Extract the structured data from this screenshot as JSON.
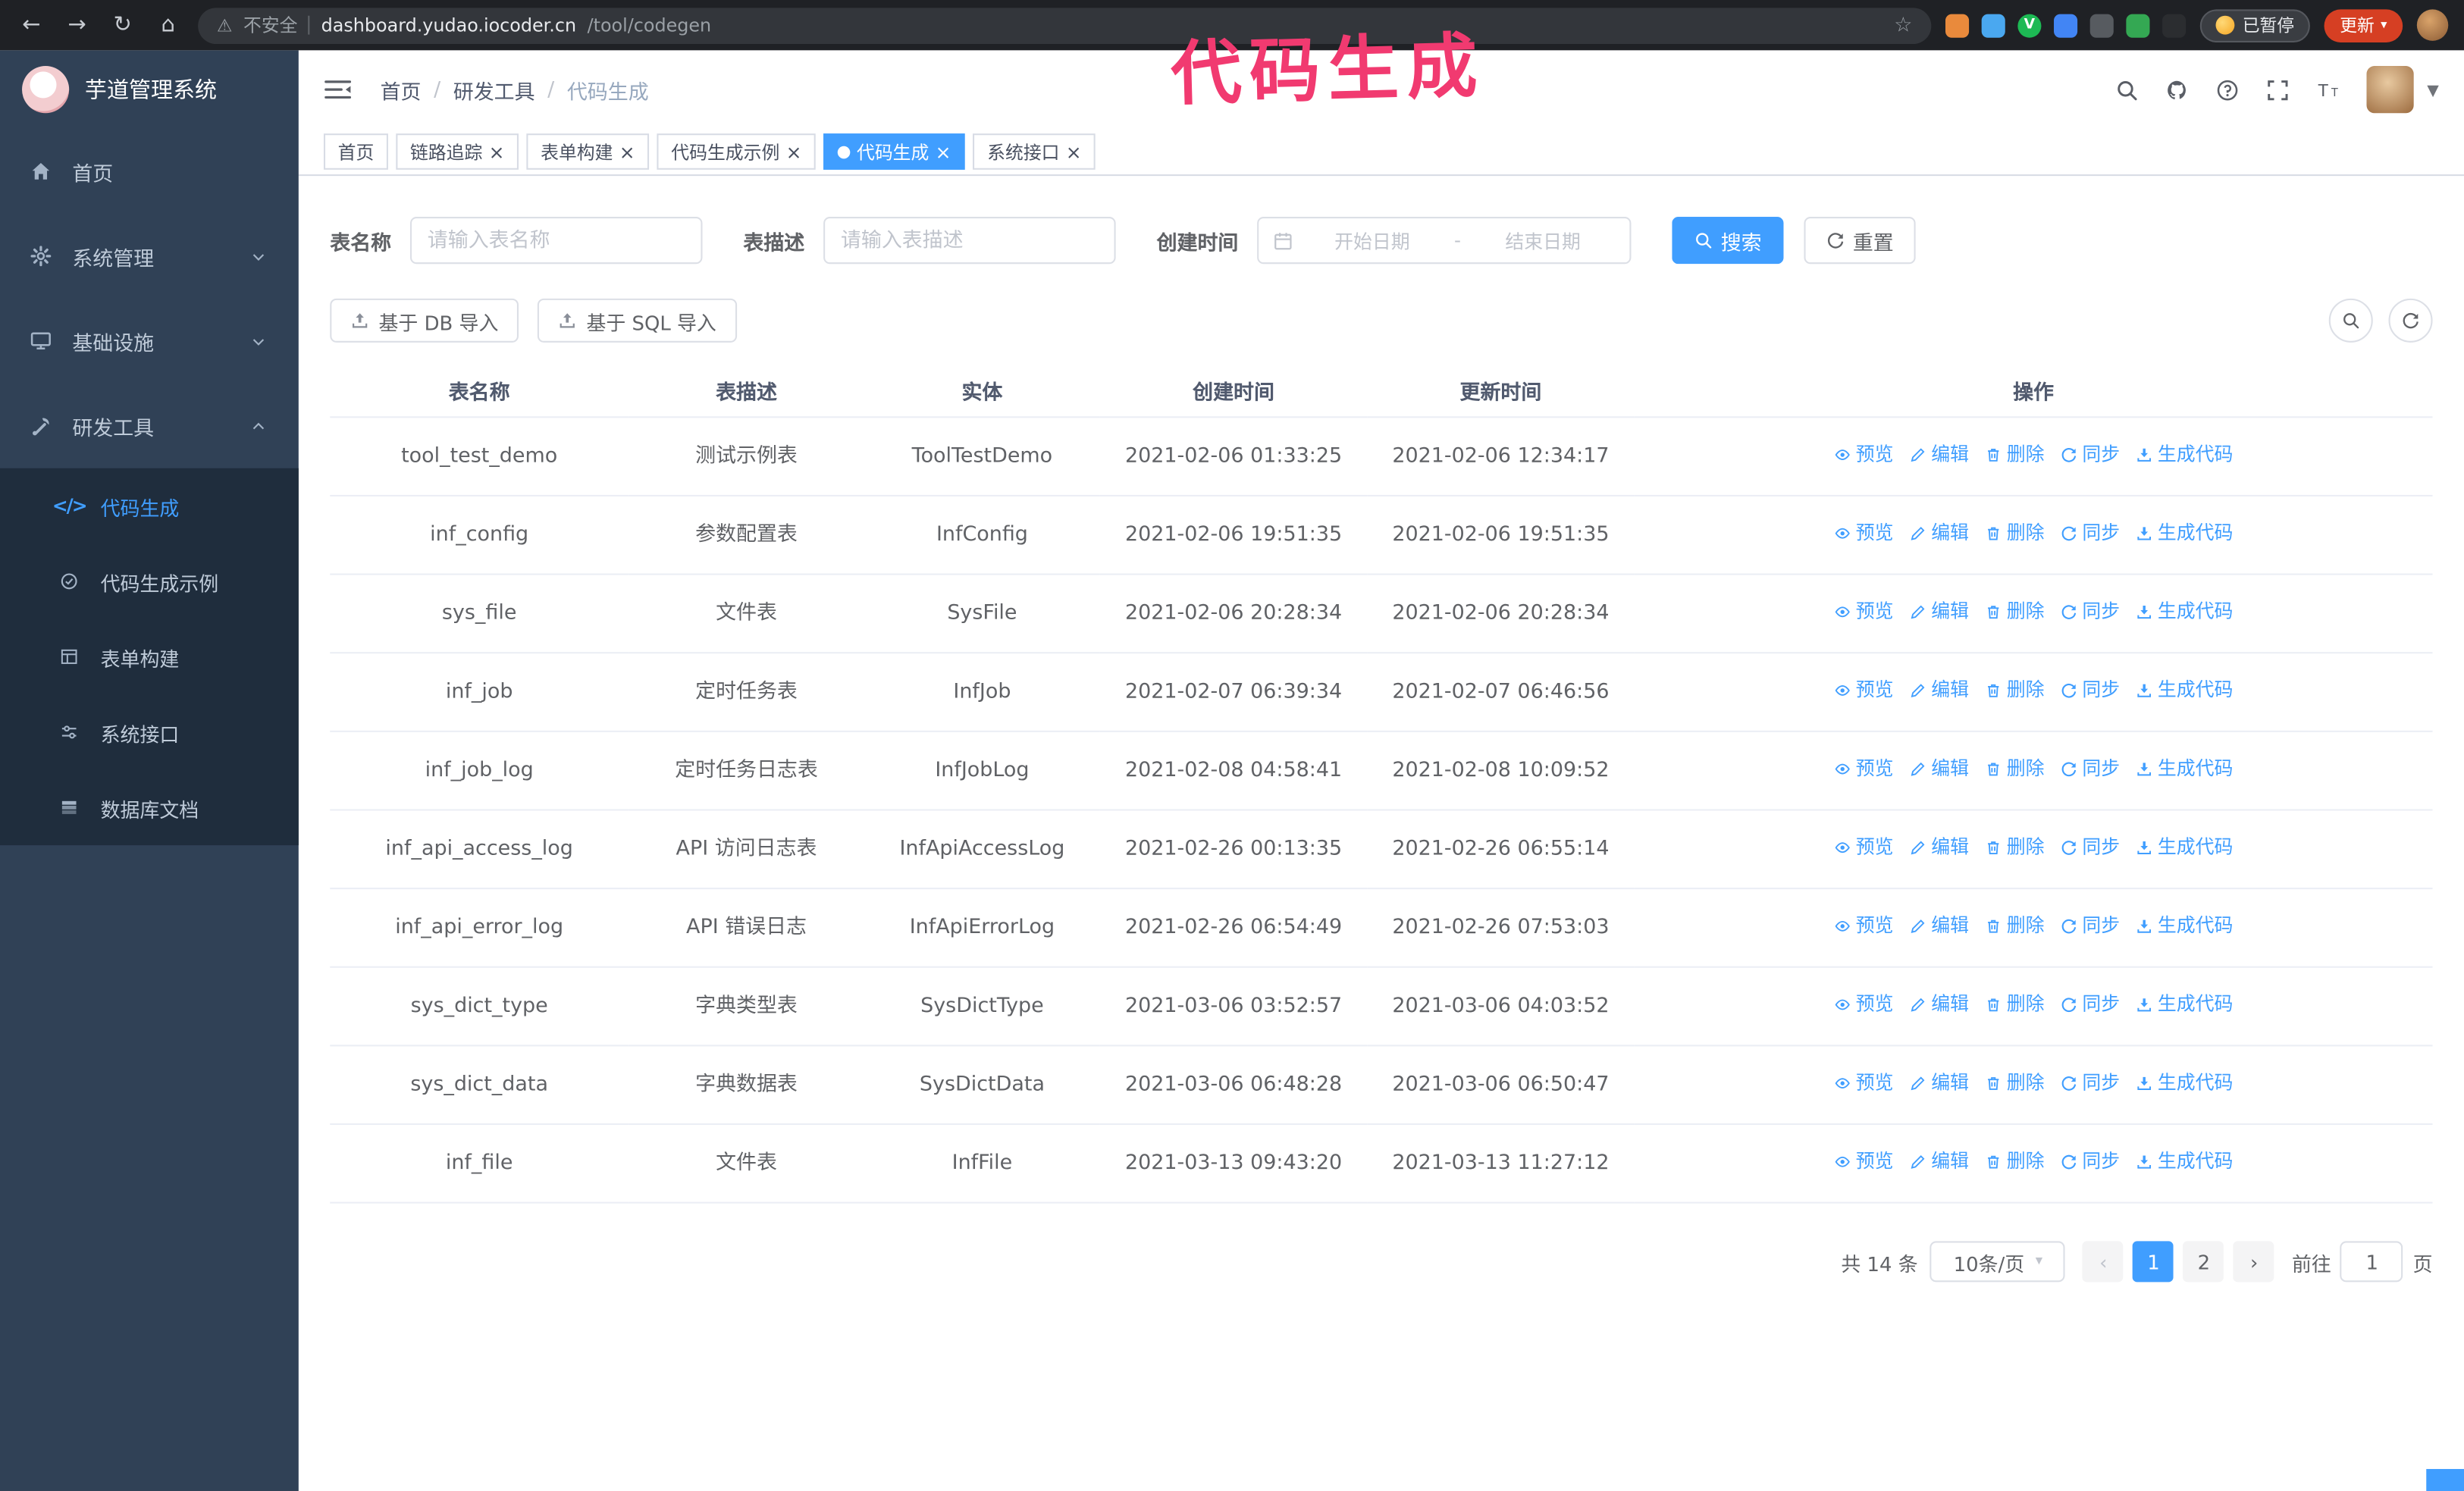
{
  "annotation": {
    "text": "代码生成"
  },
  "colors": {
    "accent": "#409eff",
    "sidebar_bg": "#304156",
    "submenu_bg": "#1f2d3d",
    "annotation": "#f13a70",
    "update_button": "#d63f23",
    "tab_active": "#409eff"
  },
  "browser": {
    "insecure_label": "不安全",
    "url_host": "dashboard.yudao.iocoder.cn",
    "url_path": "/tool/codegen",
    "paused_label": "已暂停",
    "update_label": "更新",
    "extensions": [
      {
        "name": "extension-icon-1",
        "color": "#e98a3c",
        "shape": "square"
      },
      {
        "name": "extension-icon-2",
        "color": "#4aa8f0",
        "shape": "square"
      },
      {
        "name": "extension-icon-3",
        "color": "#1db954",
        "shape": "circle",
        "letter": "V"
      },
      {
        "name": "extension-icon-4",
        "color": "#4285f4",
        "shape": "square"
      },
      {
        "name": "extension-icon-5",
        "color": "#575b60",
        "shape": "square"
      },
      {
        "name": "extension-icon-6",
        "color": "#34a853",
        "shape": "square"
      },
      {
        "name": "extension-icon-7",
        "color": "#2b2d30",
        "shape": "square"
      }
    ]
  },
  "sidebar": {
    "logo_title": "芋道管理系统",
    "menu": [
      {
        "key": "home",
        "label": "首页",
        "icon": "home-icon",
        "arrow": null
      },
      {
        "key": "system-manage",
        "label": "系统管理",
        "icon": "gear-icon",
        "arrow": "down"
      },
      {
        "key": "infrastructure",
        "label": "基础设施",
        "icon": "monitor-icon",
        "arrow": "down"
      },
      {
        "key": "devtools",
        "label": "研发工具",
        "icon": "tools-icon",
        "arrow": "up"
      }
    ],
    "submenu": [
      {
        "key": "codegen",
        "label": "代码生成",
        "icon": "code-icon",
        "active": true
      },
      {
        "key": "codegen-example",
        "label": "代码生成示例",
        "icon": "badge-icon",
        "active": false
      },
      {
        "key": "form-build",
        "label": "表单构建",
        "icon": "form-icon",
        "active": false
      },
      {
        "key": "system-api",
        "label": "系统接口",
        "icon": "api-icon",
        "active": false
      },
      {
        "key": "db-doc",
        "label": "数据库文档",
        "icon": "database-icon",
        "active": false
      }
    ]
  },
  "header": {
    "breadcrumb": [
      "首页",
      "研发工具",
      "代码生成"
    ],
    "separator": "/"
  },
  "tabs": [
    {
      "key": "home",
      "label": "首页",
      "closable": false,
      "active": false
    },
    {
      "key": "tracer",
      "label": "链路追踪",
      "closable": true,
      "active": false
    },
    {
      "key": "form-build",
      "label": "表单构建",
      "closable": true,
      "active": false
    },
    {
      "key": "codegen-example",
      "label": "代码生成示例",
      "closable": true,
      "active": false
    },
    {
      "key": "codegen",
      "label": "代码生成",
      "closable": true,
      "active": true
    },
    {
      "key": "system-api",
      "label": "系统接口",
      "closable": true,
      "active": false
    }
  ],
  "filters": {
    "table_name_label": "表名称",
    "table_name_placeholder": "请输入表名称",
    "table_desc_label": "表描述",
    "table_desc_placeholder": "请输入表描述",
    "create_time_label": "创建时间",
    "date_start_placeholder": "开始日期",
    "date_separator": "-",
    "date_end_placeholder": "结束日期",
    "search_label": "搜索",
    "reset_label": "重置"
  },
  "toolbar": {
    "import_db_label": "基于 DB 导入",
    "import_sql_label": "基于 SQL 导入"
  },
  "table": {
    "columns": [
      "表名称",
      "表描述",
      "实体",
      "创建时间",
      "更新时间",
      "操作"
    ],
    "actions": [
      "预览",
      "编辑",
      "删除",
      "同步",
      "生成代码"
    ],
    "rows": [
      {
        "name": "tool_test_demo",
        "desc": "测试示例表",
        "entity": "ToolTestDemo",
        "created": "2021-02-06 01:33:25",
        "updated": "2021-02-06 12:34:17"
      },
      {
        "name": "inf_config",
        "desc": "参数配置表",
        "entity": "InfConfig",
        "created": "2021-02-06 19:51:35",
        "updated": "2021-02-06 19:51:35"
      },
      {
        "name": "sys_file",
        "desc": "文件表",
        "entity": "SysFile",
        "created": "2021-02-06 20:28:34",
        "updated": "2021-02-06 20:28:34"
      },
      {
        "name": "inf_job",
        "desc": "定时任务表",
        "entity": "InfJob",
        "created": "2021-02-07 06:39:34",
        "updated": "2021-02-07 06:46:56"
      },
      {
        "name": "inf_job_log",
        "desc": "定时任务日志表",
        "entity": "InfJobLog",
        "created": "2021-02-08 04:58:41",
        "updated": "2021-02-08 10:09:52"
      },
      {
        "name": "inf_api_access_log",
        "desc": "API 访问日志表",
        "entity": "InfApiAccessLog",
        "created": "2021-02-26 00:13:35",
        "updated": "2021-02-26 06:55:14"
      },
      {
        "name": "inf_api_error_log",
        "desc": "API 错误日志",
        "entity": "InfApiErrorLog",
        "created": "2021-02-26 06:54:49",
        "updated": "2021-02-26 07:53:03"
      },
      {
        "name": "sys_dict_type",
        "desc": "字典类型表",
        "entity": "SysDictType",
        "created": "2021-03-06 03:52:57",
        "updated": "2021-03-06 04:03:52"
      },
      {
        "name": "sys_dict_data",
        "desc": "字典数据表",
        "entity": "SysDictData",
        "created": "2021-03-06 06:48:28",
        "updated": "2021-03-06 06:50:47"
      },
      {
        "name": "inf_file",
        "desc": "文件表",
        "entity": "InfFile",
        "created": "2021-03-13 09:43:20",
        "updated": "2021-03-13 11:27:12"
      }
    ]
  },
  "pagination": {
    "total_label": "共 14 条",
    "page_size_label": "10条/页",
    "pages": [
      "1",
      "2"
    ],
    "active_page": "1",
    "goto_prefix": "前往",
    "goto_value": "1",
    "goto_suffix": "页"
  }
}
